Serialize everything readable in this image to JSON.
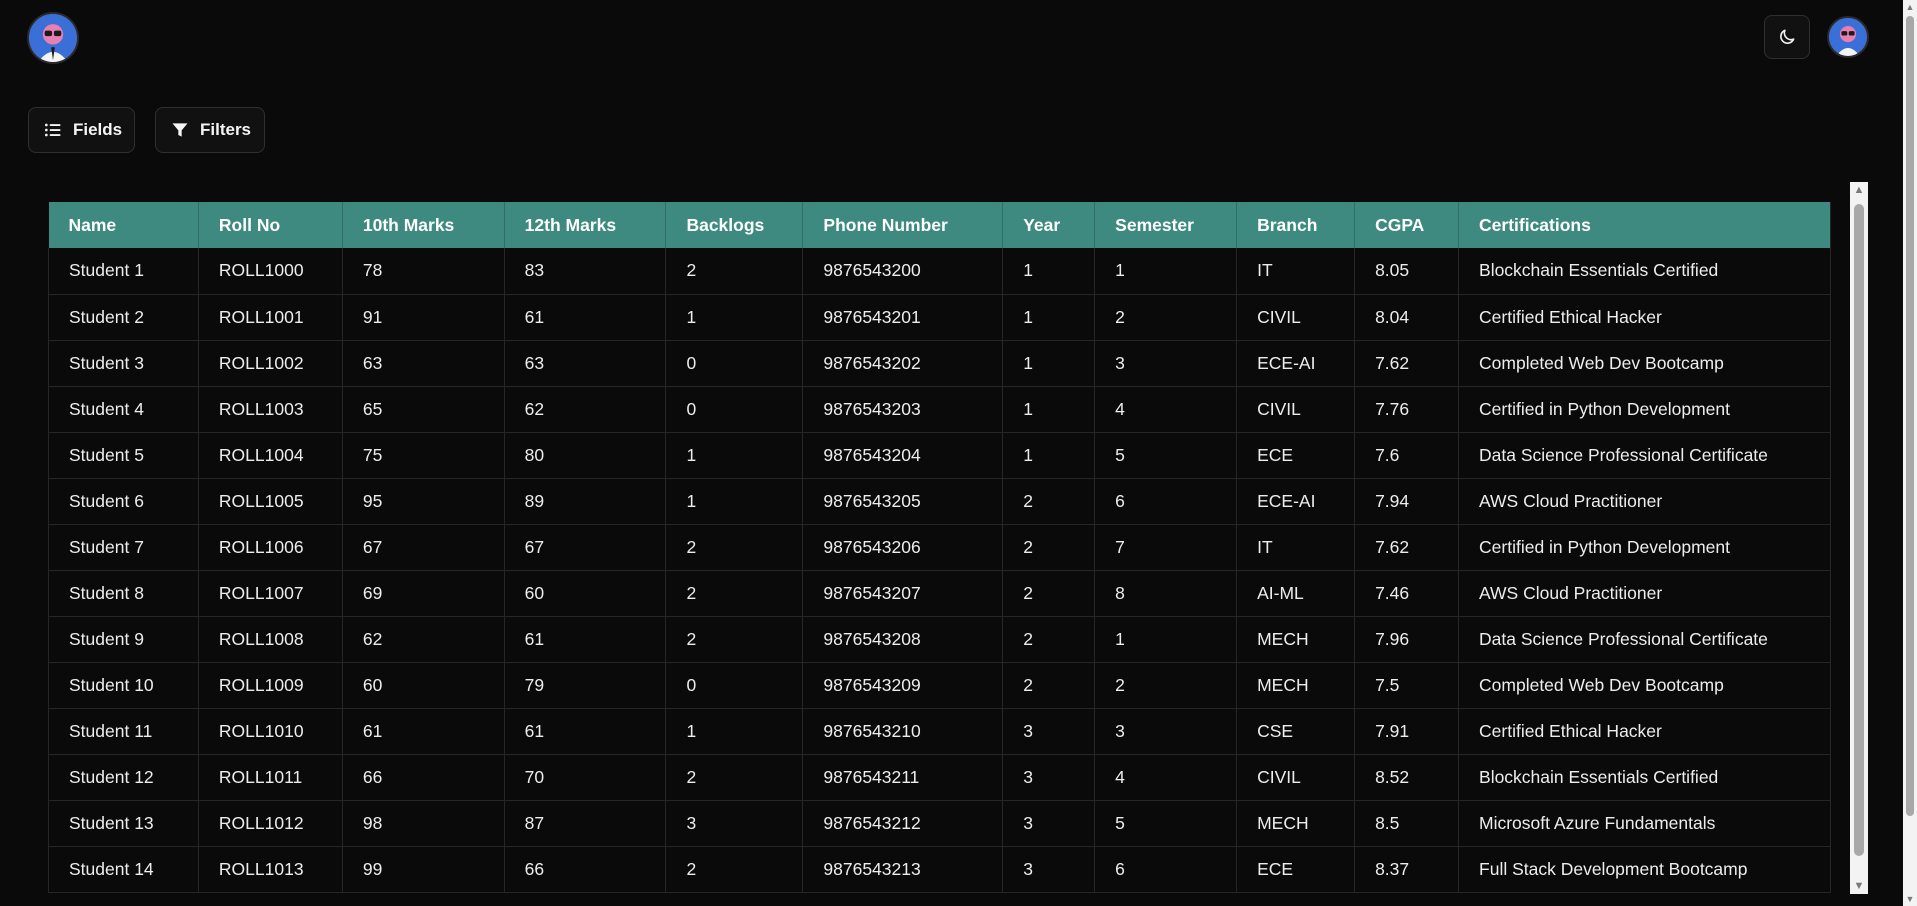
{
  "header": {
    "left_avatar_icon": "avatar-icon",
    "theme_toggle_icon": "moon-icon",
    "right_avatar_icon": "avatar-icon"
  },
  "toolbar": {
    "fields_label": "Fields",
    "fields_icon": "list-icon",
    "filters_label": "Filters",
    "filters_icon": "funnel-icon"
  },
  "table": {
    "header_color": "#3e8a80",
    "columns": [
      "Name",
      "Roll No",
      "10th Marks",
      "12th Marks",
      "Backlogs",
      "Phone Number",
      "Year",
      "Semester",
      "Branch",
      "CGPA",
      "Certifications"
    ],
    "rows": [
      [
        "Student 1",
        "ROLL1000",
        "78",
        "83",
        "2",
        "9876543200",
        "1",
        "1",
        "IT",
        "8.05",
        "Blockchain Essentials Certified"
      ],
      [
        "Student 2",
        "ROLL1001",
        "91",
        "61",
        "1",
        "9876543201",
        "1",
        "2",
        "CIVIL",
        "8.04",
        "Certified Ethical Hacker"
      ],
      [
        "Student 3",
        "ROLL1002",
        "63",
        "63",
        "0",
        "9876543202",
        "1",
        "3",
        "ECE-AI",
        "7.62",
        "Completed Web Dev Bootcamp"
      ],
      [
        "Student 4",
        "ROLL1003",
        "65",
        "62",
        "0",
        "9876543203",
        "1",
        "4",
        "CIVIL",
        "7.76",
        "Certified in Python Development"
      ],
      [
        "Student 5",
        "ROLL1004",
        "75",
        "80",
        "1",
        "9876543204",
        "1",
        "5",
        "ECE",
        "7.6",
        "Data Science Professional Certificate"
      ],
      [
        "Student 6",
        "ROLL1005",
        "95",
        "89",
        "1",
        "9876543205",
        "2",
        "6",
        "ECE-AI",
        "7.94",
        "AWS Cloud Practitioner"
      ],
      [
        "Student 7",
        "ROLL1006",
        "67",
        "67",
        "2",
        "9876543206",
        "2",
        "7",
        "IT",
        "7.62",
        "Certified in Python Development"
      ],
      [
        "Student 8",
        "ROLL1007",
        "69",
        "60",
        "2",
        "9876543207",
        "2",
        "8",
        "AI-ML",
        "7.46",
        "AWS Cloud Practitioner"
      ],
      [
        "Student 9",
        "ROLL1008",
        "62",
        "61",
        "2",
        "9876543208",
        "2",
        "1",
        "MECH",
        "7.96",
        "Data Science Professional Certificate"
      ],
      [
        "Student 10",
        "ROLL1009",
        "60",
        "79",
        "0",
        "9876543209",
        "2",
        "2",
        "MECH",
        "7.5",
        "Completed Web Dev Bootcamp"
      ],
      [
        "Student 11",
        "ROLL1010",
        "61",
        "61",
        "1",
        "9876543210",
        "3",
        "3",
        "CSE",
        "7.91",
        "Certified Ethical Hacker"
      ],
      [
        "Student 12",
        "ROLL1011",
        "66",
        "70",
        "2",
        "9876543211",
        "3",
        "4",
        "CIVIL",
        "8.52",
        "Blockchain Essentials Certified"
      ],
      [
        "Student 13",
        "ROLL1012",
        "98",
        "87",
        "3",
        "9876543212",
        "3",
        "5",
        "MECH",
        "8.5",
        "Microsoft Azure Fundamentals"
      ],
      [
        "Student 14",
        "ROLL1013",
        "99",
        "66",
        "2",
        "9876543213",
        "3",
        "6",
        "ECE",
        "8.37",
        "Full Stack Development Bootcamp"
      ]
    ]
  }
}
